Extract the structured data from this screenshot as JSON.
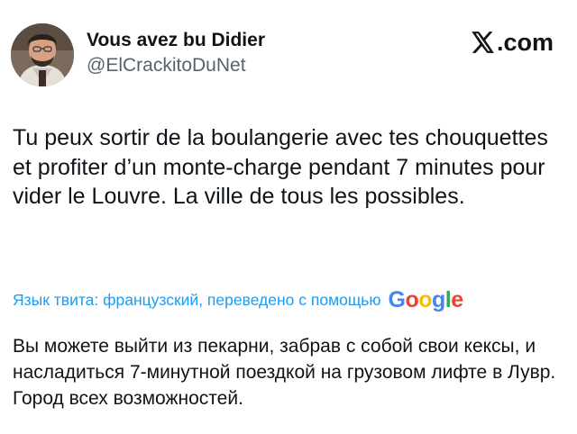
{
  "author": {
    "display_name": "Vous avez bu Didier",
    "handle": "@ElCrackitoDuNet",
    "avatar_icon": "user-avatar-photo"
  },
  "brand": {
    "logo_icon": "x-logo-icon",
    "suffix": ".com"
  },
  "tweet": {
    "text": "Tu peux sortir de la boulangerie avec tes chouquettes et profiter d’un monte-charge pendant 7 minutes pour vider le Louvre. La ville de tous les possibles."
  },
  "translation": {
    "label": "Язык твита: французский, переведено с помощью",
    "provider": "Google",
    "provider_colors": [
      "#4285F4",
      "#EA4335",
      "#FBBC05",
      "#4285F4",
      "#34A853",
      "#EA4335"
    ],
    "text": "Вы можете выйти из пекарни, забрав с собой свои кексы, и насладиться 7-минутной поездкой на грузовом лифте в Лувр. Город всех возможностей."
  },
  "colors": {
    "link": "#1d9bf0",
    "secondary_text": "#536471",
    "primary_text": "#0f1419"
  }
}
